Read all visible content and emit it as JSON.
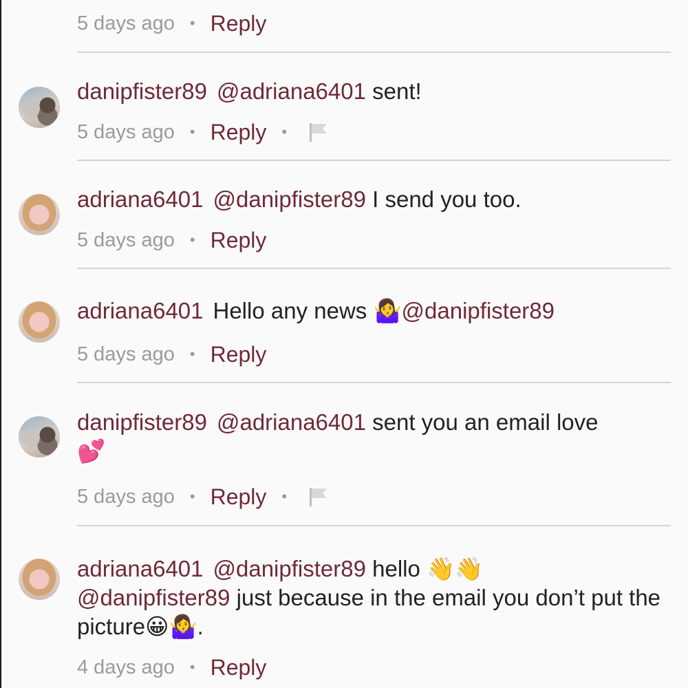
{
  "comments": [
    {
      "time": "5 days ago",
      "reply": "Reply"
    },
    {
      "user": "danipfister89",
      "mention": "@adriana6401",
      "text": " sent!",
      "time": "5 days ago",
      "reply": "Reply"
    },
    {
      "user": "adriana6401",
      "mention": "@danipfister89",
      "text": " I send you too.",
      "time": "5 days ago",
      "reply": "Reply"
    },
    {
      "user": "adriana6401",
      "text": "Hello any news ",
      "emoji": "🤷‍♀️",
      "mention": "@danipfister89",
      "time": "5 days ago",
      "reply": "Reply"
    },
    {
      "user": "danipfister89",
      "mention": "@adriana6401",
      "text": " sent you an email love",
      "emoji": "💕",
      "time": "5 days ago",
      "reply": "Reply"
    },
    {
      "user": "adriana6401",
      "mention": "@danipfister89",
      "text": " hello ",
      "emoji": "👋👋",
      "mention2": "@danipfister89",
      "text2": "  just because in the email you don’t put the picture",
      "emoji2": "😀🤷‍♀️",
      "text3": ".",
      "time": "4 days ago",
      "reply": "Reply"
    }
  ],
  "separator": "•",
  "icons": {
    "flag": "flag-icon"
  }
}
